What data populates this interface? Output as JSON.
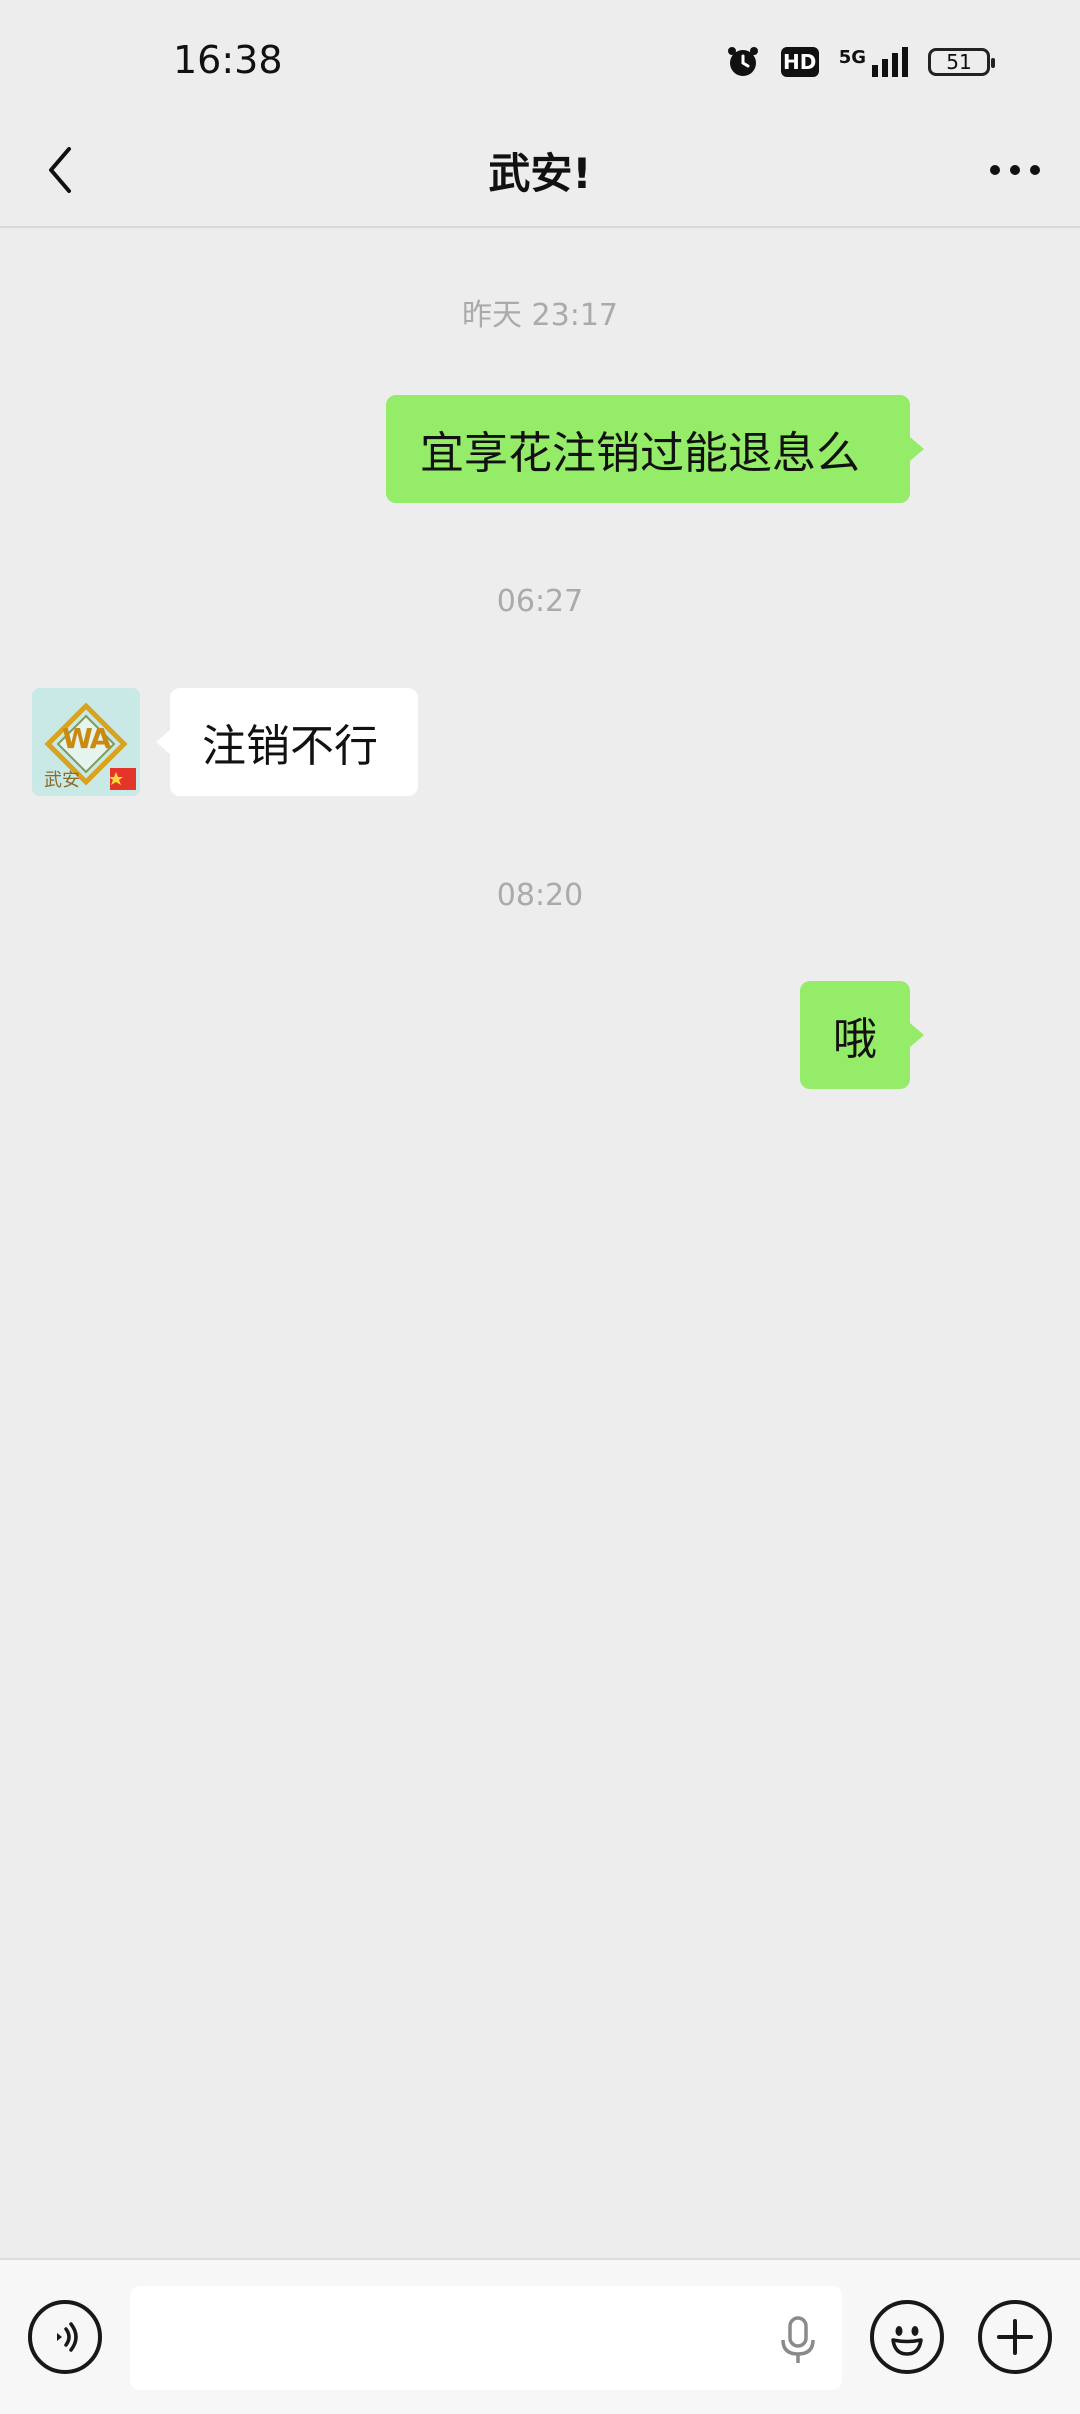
{
  "status_bar": {
    "time": "16:38",
    "hd": "HD",
    "network": "5G",
    "battery": "51"
  },
  "header": {
    "title": "武安!"
  },
  "messages": [
    {
      "type": "timestamp",
      "text": "昨天 23:17"
    },
    {
      "type": "sent",
      "text": "宜享花注销过能退息么"
    },
    {
      "type": "timestamp",
      "text": "06:27"
    },
    {
      "type": "received",
      "text": "注销不行"
    },
    {
      "type": "timestamp",
      "text": "08:20"
    },
    {
      "type": "sent",
      "text": "哦"
    }
  ],
  "contact_avatar": {
    "logo_text_top": "WA",
    "logo_text_bottom": "武安"
  },
  "input_bar": {
    "input_value": "",
    "icons": [
      "voice-icon",
      "microphone-icon",
      "emoji-icon",
      "plus-icon"
    ]
  }
}
